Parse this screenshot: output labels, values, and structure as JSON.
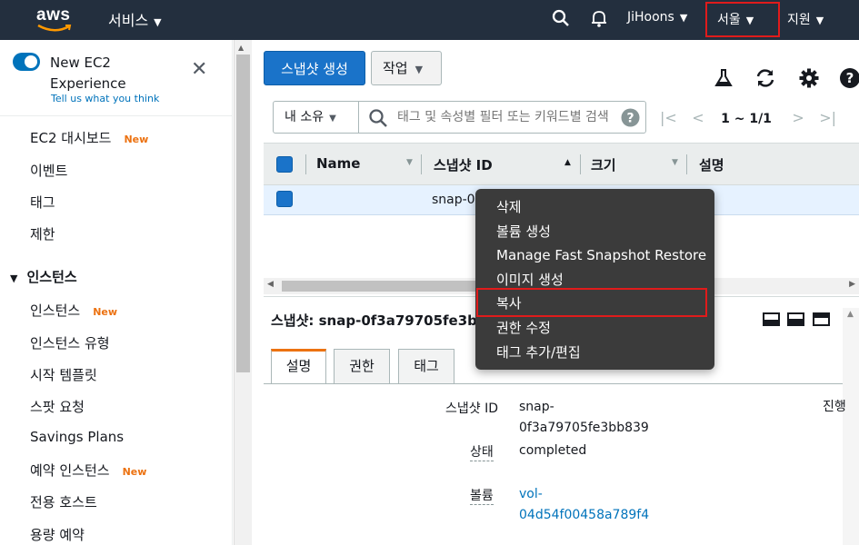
{
  "topbar": {
    "logo": "aws",
    "services": "서비스",
    "user": "JiHoons",
    "region": "서울",
    "support": "지원"
  },
  "sidebar": {
    "experience_title": "New EC2 Experience",
    "experience_link": "Tell us what you think",
    "new_badge": "New",
    "items": [
      {
        "label": "EC2 대시보드",
        "new": true
      },
      {
        "label": "이벤트"
      },
      {
        "label": "태그"
      },
      {
        "label": "제한"
      }
    ],
    "section": "인스턴스",
    "section_items": [
      {
        "label": "인스턴스",
        "new": true
      },
      {
        "label": "인스턴스 유형"
      },
      {
        "label": "시작 템플릿"
      },
      {
        "label": "스팟 요청"
      },
      {
        "label": "Savings Plans"
      },
      {
        "label": "예약 인스턴스",
        "new": true
      },
      {
        "label": "전용 호스트"
      },
      {
        "label": "용량 예약"
      }
    ]
  },
  "toolbar": {
    "create_snapshot": "스냅샷 생성",
    "actions": "작업"
  },
  "filter": {
    "owner": "내 소유",
    "placeholder": "태그 및 속성별 필터 또는 키워드별 검색"
  },
  "pager": "1 ~ 1/1",
  "table": {
    "columns": [
      "Name",
      "스냅샷 ID",
      "크기",
      "설명"
    ],
    "rows": [
      {
        "name": "",
        "snapshot_id": "snap-0"
      }
    ]
  },
  "context_menu": {
    "items": [
      "삭제",
      "볼륨 생성",
      "Manage Fast Snapshot Restore",
      "이미지 생성",
      "복사",
      "권한 수정",
      "태그 추가/편집"
    ],
    "highlighted": "복사"
  },
  "details": {
    "title": "스냅샷: snap-0f3a79705fe3bb",
    "tabs": [
      "설명",
      "권한",
      "태그"
    ],
    "fields": {
      "snapshot_id_label": "스냅샷 ID",
      "snapshot_id_line1": "snap-",
      "snapshot_id_line2": "0f3a79705fe3bb839",
      "status_label": "상태",
      "status_value": "completed",
      "volume_label": "볼륨",
      "volume_line1": "vol-",
      "volume_line2": "04d54f00458a789f4",
      "progress_label": "진행"
    }
  },
  "colors": {
    "nav_bg": "#232f3e",
    "primary": "#1a73c9",
    "accent": "#ec7211",
    "highlight_box": "#e01b1b",
    "menu_bg": "#3b3b3b"
  }
}
